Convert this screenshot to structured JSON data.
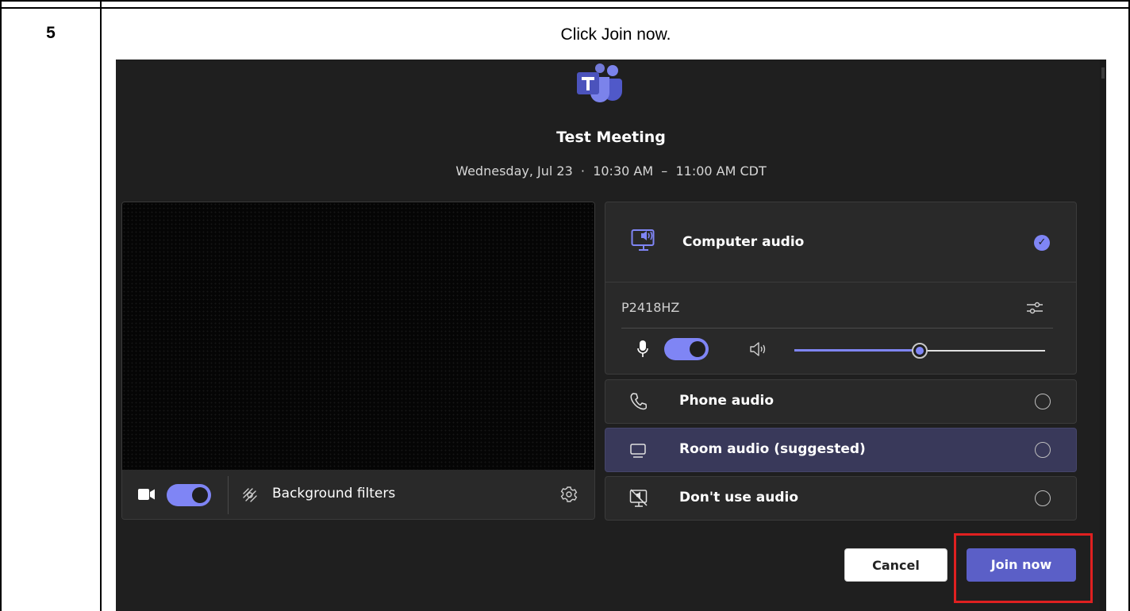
{
  "step": {
    "number": "5",
    "instruction": "Click Join now."
  },
  "meeting": {
    "title": "Test Meeting",
    "time": "Wednesday, Jul 23  ·  10:30 AM  –  11:00 AM CDT"
  },
  "video": {
    "camera_on": true,
    "background_filters_label": "Background filters"
  },
  "audio": {
    "computer_audio_label": "Computer audio",
    "computer_audio_selected": true,
    "device_name": "P2418HZ",
    "mic_on": true,
    "volume_level": 0.5,
    "options": [
      {
        "label": "Phone audio",
        "selected": false,
        "suggested": false,
        "icon": "phone-icon"
      },
      {
        "label": "Room audio (suggested)",
        "selected": false,
        "suggested": true,
        "icon": "room-audio-icon"
      },
      {
        "label": "Don't use audio",
        "selected": false,
        "suggested": false,
        "icon": "no-audio-icon"
      }
    ]
  },
  "buttons": {
    "cancel": "Cancel",
    "join": "Join now"
  },
  "colors": {
    "accent": "#7f85f5",
    "join_button": "#5b5fc7",
    "background": "#1f1f1f",
    "highlight": "#e02020"
  }
}
